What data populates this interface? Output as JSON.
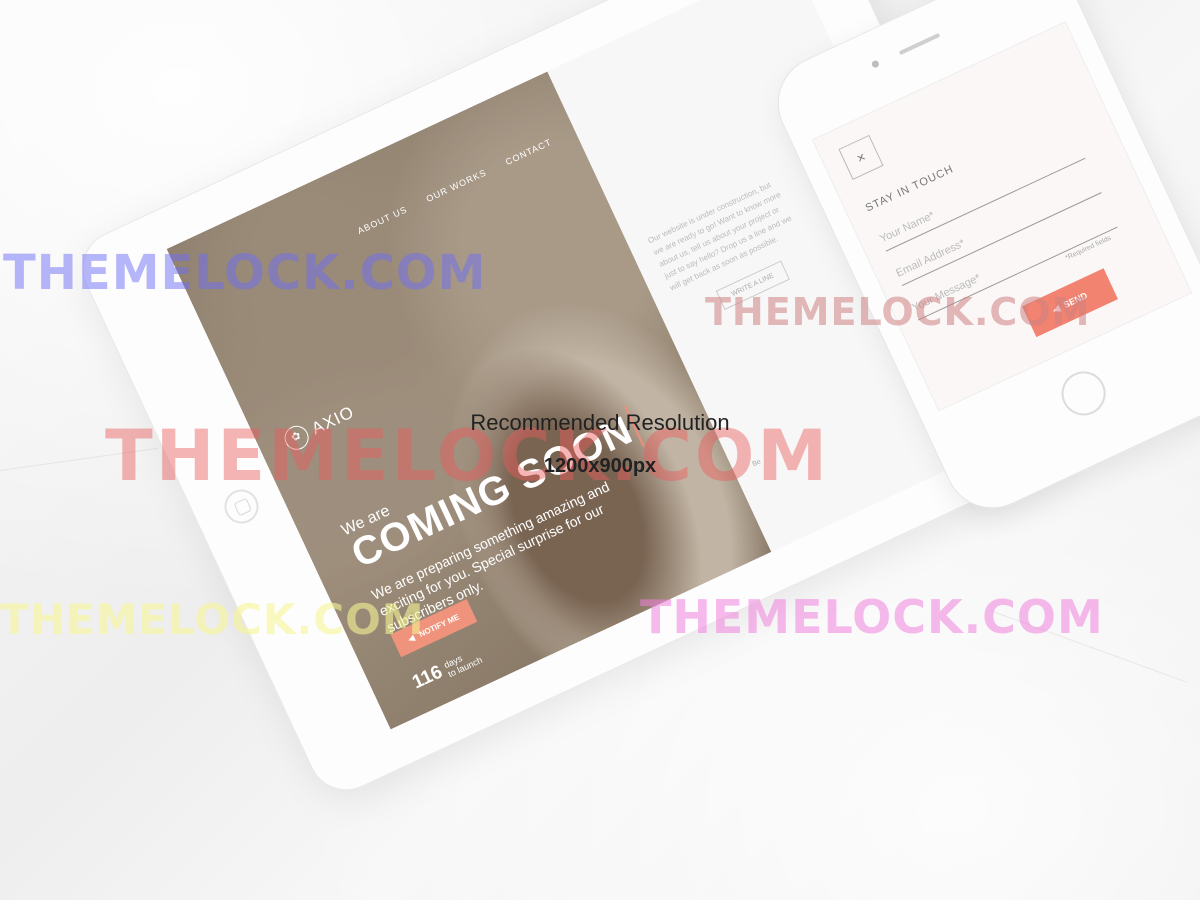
{
  "tablet": {
    "nav": [
      "ABOUT US",
      "OUR WORKS",
      "CONTACT"
    ],
    "logo_text": "AXIO",
    "hero_pre": "We are",
    "hero_title": "COMING SOON",
    "hero_desc": "We are preparing something amazing and exciting for you. Special surprise for our subscribers only.",
    "notify_label": "NOTIFY ME",
    "countdown_value": "116",
    "countdown_unit": "days",
    "countdown_suffix": "to launch",
    "panel_text": "Our website is under construction, but we are ready to go! Want to know more about us, tell us about your project or just to say hello? Drop us a line and we will get back as soon as possible.",
    "write_label": "WRITE A LINE",
    "panel_footer": "Be"
  },
  "phone": {
    "title": "STAY IN TOUCH",
    "name_placeholder": "Your Name*",
    "email_placeholder": "Email Address*",
    "message_placeholder": "Your Message*",
    "required_note": "*Required fields",
    "send_label": "SEND"
  },
  "overlay": {
    "watermark": "THEMELOCK.COM",
    "title": "Recommended Resolution",
    "size": "1200x900px"
  },
  "colors": {
    "accent": "#f28370",
    "background": "#f2f2f2"
  }
}
